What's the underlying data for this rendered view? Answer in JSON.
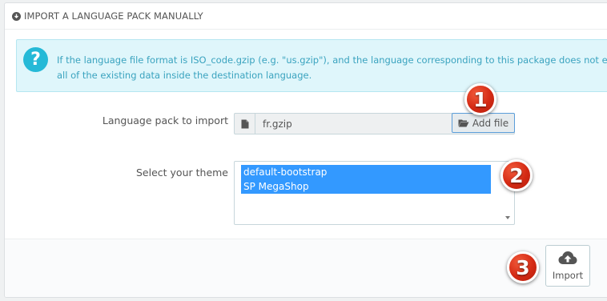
{
  "panel": {
    "heading": "IMPORT A LANGUAGE PACK MANUALLY",
    "heading_icon": "download-circle-icon"
  },
  "alert": {
    "icon": "question-icon",
    "icon_glyph": "?",
    "line1": "If the language file format is ISO_code.gzip (e.g. \"us.gzip\"), and the language corresponding to this package does not exist,",
    "line2": "all of the existing data inside the destination language."
  },
  "language_pack": {
    "label": "Language pack to import",
    "file_name": "fr.gzip",
    "file_icon": "file-icon",
    "add_button": "Add file",
    "add_icon": "folder-open-icon"
  },
  "theme": {
    "label": "Select your theme",
    "options": [
      "default-bootstrap",
      "SP MegaShop"
    ]
  },
  "footer": {
    "import_label": "Import",
    "import_icon": "cloud-upload-icon"
  },
  "badges": [
    "1",
    "2",
    "3"
  ],
  "colors": {
    "accent": "#25b9d7",
    "selected": "#3399ff",
    "badge": "#d42a14"
  }
}
